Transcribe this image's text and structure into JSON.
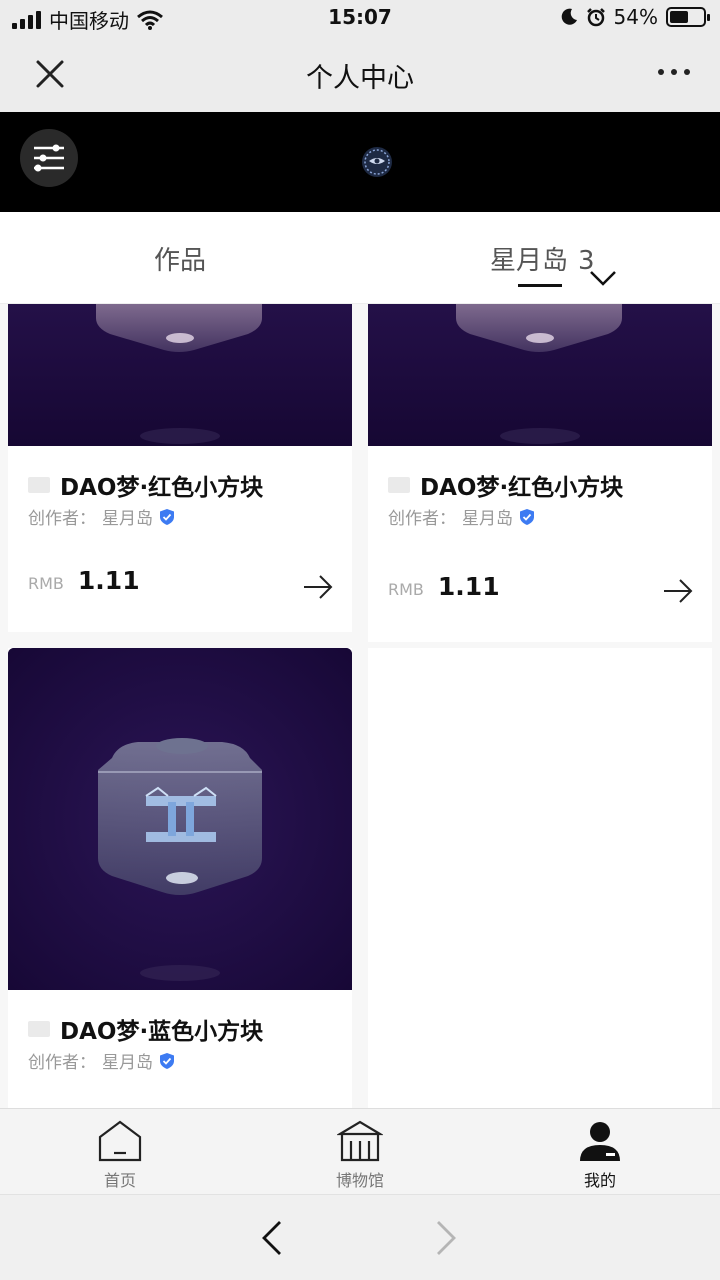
{
  "status_bar": {
    "carrier": "中国移动",
    "time": "15:07",
    "battery_percent": "54%",
    "battery_level": 0.54,
    "icons": [
      "signal-icon",
      "wifi-icon",
      "moon-icon",
      "alarm-icon",
      "battery-icon"
    ]
  },
  "nav": {
    "title": "个人中心",
    "close_icon": "close-icon",
    "more_icon": "more-icon"
  },
  "banner": {
    "filter_icon": "filter-icon",
    "logo_icon": "logo-icon"
  },
  "tabs": {
    "works_label": "作品",
    "island_label": "星月岛",
    "island_count": "3",
    "active": "island"
  },
  "cards": [
    {
      "title": "DAO梦·红色小方块",
      "creator_label": "创作者：",
      "creator": "星月岛",
      "currency": "RMB",
      "price": "1.11"
    },
    {
      "title": "DAO梦·红色小方块",
      "creator_label": "创作者：",
      "creator": "星月岛",
      "currency": "RMB",
      "price": "1.11"
    },
    {
      "title": "DAO梦·蓝色小方块",
      "creator_label": "创作者：",
      "creator": "星月岛"
    }
  ],
  "tabbar": {
    "items": [
      {
        "label": "首页",
        "icon": "home-icon"
      },
      {
        "label": "博物馆",
        "icon": "museum-icon"
      },
      {
        "label": "我的",
        "icon": "profile-icon",
        "active": true
      }
    ]
  },
  "browser_nav": {
    "back_icon": "chevron-left-icon",
    "forward_icon": "chevron-right-icon"
  },
  "colors": {
    "artwork_bg": "#1b0b3c",
    "verified_blue": "#3d7bf2",
    "banner_bg": "#000000"
  }
}
